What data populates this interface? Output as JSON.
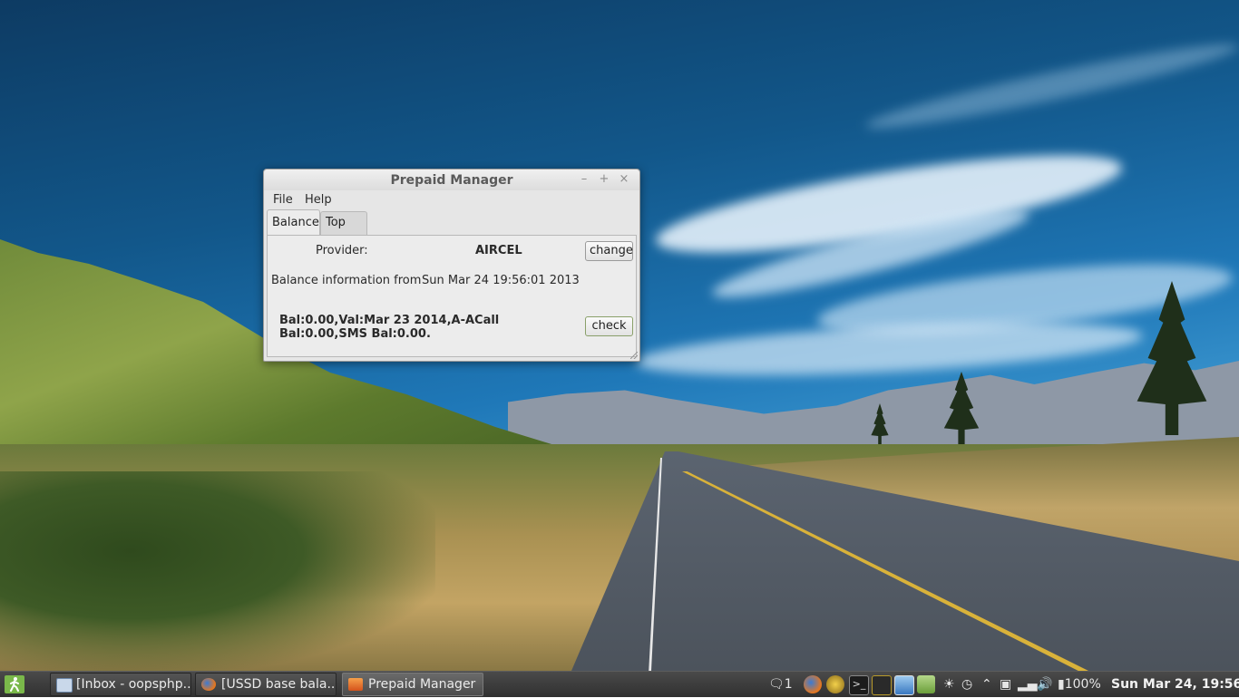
{
  "window": {
    "title": "Prepaid Manager",
    "menu": [
      "File",
      "Help"
    ],
    "tabs": [
      "Balance",
      "Top up"
    ],
    "active_tab": "Balance",
    "balance": {
      "provider_label": "Provider:",
      "provider_value": "AIRCEL",
      "change_label": "change",
      "info_label": "Balance information from",
      "info_time": "Sun Mar 24 19:56:01 2013",
      "result_text": "Bal:0.00,Val:Mar 23 2014,A-ACall Bal:0.00,SMS Bal:0.00.",
      "check_label": "check"
    },
    "controls": {
      "minimize": "–",
      "maximize": "+",
      "close": "×"
    }
  },
  "taskbar": {
    "tasks": [
      {
        "label": "[Inbox - oopsphp...",
        "icon": "mail-client-icon"
      },
      {
        "label": "[USSD base bala...",
        "icon": "firefox-icon"
      },
      {
        "label": "Prepaid Manager",
        "icon": "prepaid-manager-icon",
        "active": true
      }
    ],
    "tray": {
      "message_count": "1",
      "battery": "100%",
      "clock": "Sun Mar 24, 19:56"
    }
  }
}
